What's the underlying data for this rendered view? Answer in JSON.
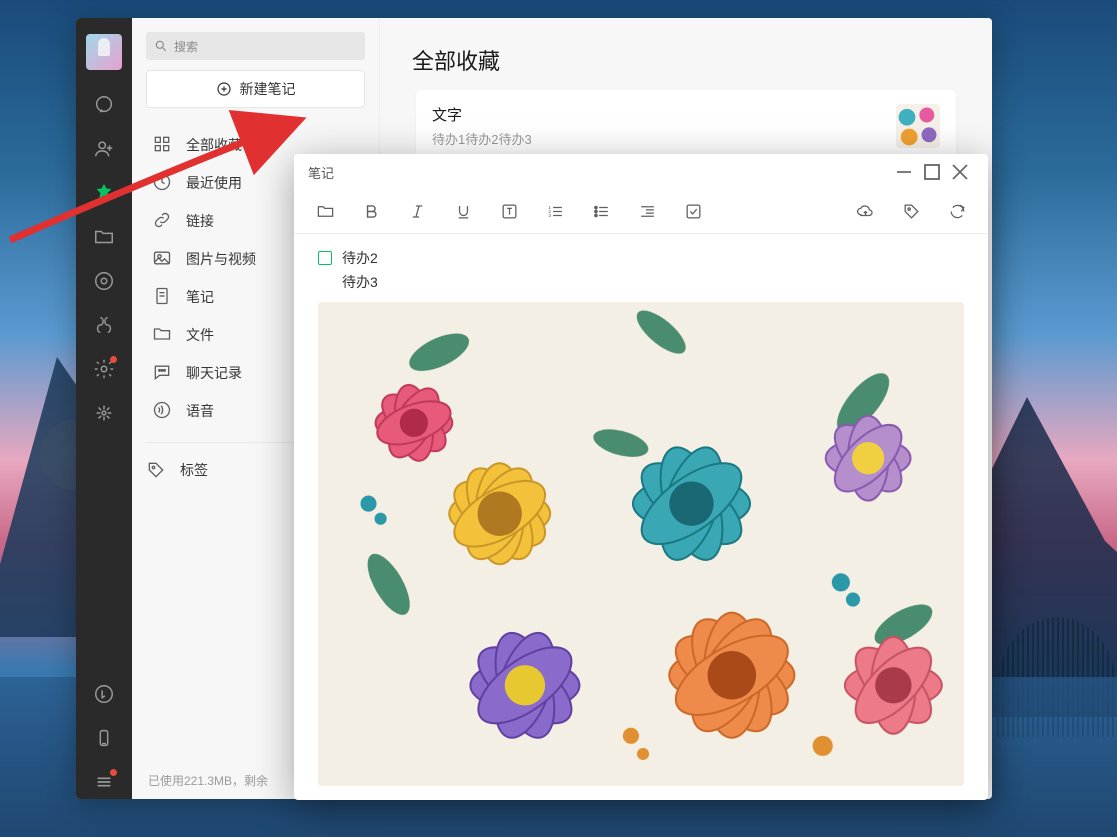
{
  "wallpaper": {
    "theme": "sunset-mountains"
  },
  "mainWindow": {
    "titlebar": {
      "pin": "📌"
    }
  },
  "rail": {
    "items": [
      {
        "name": "chat-icon",
        "active": false
      },
      {
        "name": "contacts-icon",
        "active": false
      },
      {
        "name": "favorites-icon",
        "active": true
      },
      {
        "name": "files-icon",
        "active": false
      },
      {
        "name": "moments-icon",
        "active": false
      },
      {
        "name": "channels-icon",
        "active": false
      },
      {
        "name": "plugins-icon",
        "active": false,
        "badge": true
      },
      {
        "name": "miniapp-icon",
        "active": false
      }
    ],
    "bottom": [
      {
        "name": "music-icon"
      },
      {
        "name": "phone-icon"
      },
      {
        "name": "menu-icon",
        "badge": true
      }
    ]
  },
  "sidebar": {
    "searchPlaceholder": "搜索",
    "newNoteLabel": "新建笔记",
    "categories": [
      {
        "icon": "grid-icon",
        "label": "全部收藏"
      },
      {
        "icon": "clock-icon",
        "label": "最近使用"
      },
      {
        "icon": "link-icon",
        "label": "链接"
      },
      {
        "icon": "image-icon",
        "label": "图片与视频"
      },
      {
        "icon": "note-icon",
        "label": "笔记"
      },
      {
        "icon": "folder-icon",
        "label": "文件"
      },
      {
        "icon": "chat-log-icon",
        "label": "聊天记录"
      },
      {
        "icon": "voice-icon",
        "label": "语音"
      }
    ],
    "tagsLabel": "标签",
    "footer": "已使用221.3MB，剩余"
  },
  "content": {
    "pageTitle": "全部收藏",
    "card": {
      "title": "文字",
      "subtitle": "待办1待办2待办3"
    }
  },
  "editor": {
    "title": "笔记",
    "todoLines": [
      {
        "checked": false,
        "text": "待办2",
        "showBox": true
      },
      {
        "checked": false,
        "text": "待办3",
        "showBox": false
      }
    ],
    "toolbar": [
      "folder",
      "bold",
      "italic",
      "underline",
      "text-style",
      "ordered-list",
      "unordered-list",
      "indent",
      "checklist"
    ],
    "toolbarRight": [
      "cloud-upload",
      "tag",
      "share"
    ]
  },
  "annotation": {
    "arrowColor": "#e03030"
  }
}
